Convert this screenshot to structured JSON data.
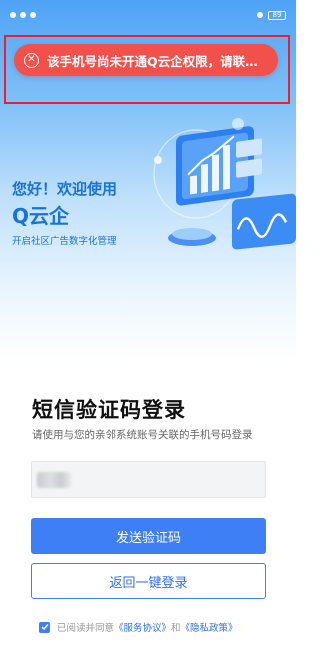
{
  "status_bar": {
    "battery": "89"
  },
  "toast": {
    "icon": "close-circle-icon",
    "message": "该手机号尚未开通Q云企权限，请联系管理员"
  },
  "hero": {
    "greeting": "您好！欢迎使用",
    "brand": "Q云企",
    "tagline": "开启社区广告数字化管理"
  },
  "login": {
    "title": "短信验证码登录",
    "subtitle": "请使用与您的亲邻系统账号关联的手机号码登录",
    "phone_value": "",
    "send_code_button": "发送验证码",
    "one_click_login_button": "返回一键登录"
  },
  "agreement": {
    "checked": true,
    "prefix": "已阅读并同意",
    "service_link": "《服务协议》",
    "conjunction": "和",
    "privacy_link": "《隐私政策》"
  },
  "colors": {
    "accent": "#3f7ff5",
    "toast": "#f2504b",
    "highlight_frame": "#e8212a",
    "brand_text": "#1a73d8"
  }
}
